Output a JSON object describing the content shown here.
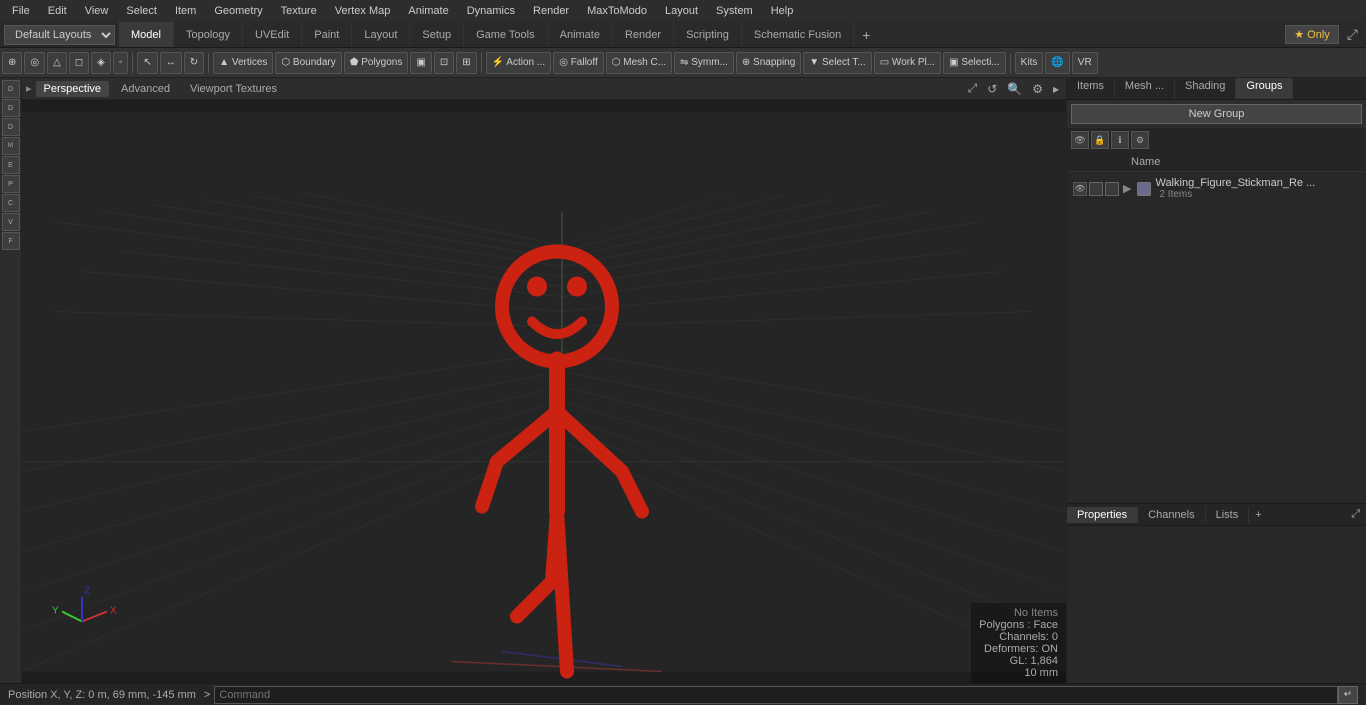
{
  "menubar": {
    "items": [
      "File",
      "Edit",
      "View",
      "Select",
      "Item",
      "Geometry",
      "Texture",
      "Vertex Map",
      "Animate",
      "Dynamics",
      "Render",
      "MaxToModo",
      "Layout",
      "System",
      "Help"
    ]
  },
  "layout_bar": {
    "dropdown": "Default Layouts",
    "tabs": [
      "Model",
      "Topology",
      "UVEdit",
      "Paint",
      "Layout",
      "Setup",
      "Game Tools",
      "Animate",
      "Render",
      "Scripting",
      "Schematic Fusion"
    ],
    "active_tab": "Model",
    "star_only": "★ Only"
  },
  "toolbar": {
    "buttons": [
      {
        "label": "⊕",
        "name": "item-mode"
      },
      {
        "label": "⊙",
        "name": "component-mode"
      },
      {
        "label": "△",
        "name": "vertex-mode"
      },
      {
        "label": "◻",
        "name": "edge-mode"
      },
      {
        "label": "◈",
        "name": "polygon-mode"
      },
      {
        "label": "◦",
        "name": "material-mode"
      },
      {
        "label": "⬡",
        "name": "select-tool"
      },
      {
        "label": "↔",
        "name": "transform-tool"
      },
      {
        "label": "✦",
        "name": "rotate-tool"
      },
      {
        "label": "Vertices",
        "name": "vertices-btn"
      },
      {
        "label": "Boundary",
        "name": "boundary-btn"
      },
      {
        "label": "Polygons",
        "name": "polygons-btn"
      },
      {
        "label": "▣",
        "name": "display-btn"
      },
      {
        "label": "⊡",
        "name": "wireframe-btn"
      },
      {
        "label": "⊞",
        "name": "solid-btn"
      },
      {
        "label": "Action...",
        "name": "action-btn"
      },
      {
        "label": "Falloff",
        "name": "falloff-btn"
      },
      {
        "label": "Mesh C...",
        "name": "mesh-btn"
      },
      {
        "label": "Symm...",
        "name": "symmetry-btn"
      },
      {
        "label": "Snapping",
        "name": "snapping-btn"
      },
      {
        "label": "Select T...",
        "name": "select-type-btn"
      },
      {
        "label": "Work Pl...",
        "name": "workplane-btn"
      },
      {
        "label": "Selecti...",
        "name": "selection-btn"
      },
      {
        "label": "Kits",
        "name": "kits-btn"
      }
    ]
  },
  "viewport": {
    "tabs": [
      "Perspective",
      "Advanced",
      "Viewport Textures"
    ],
    "active_tab": "Perspective",
    "status": {
      "no_items": "No Items",
      "polygons": "Polygons : Face",
      "channels": "Channels: 0",
      "deformers": "Deformers: ON",
      "gl": "GL: 1,864",
      "grid": "10 mm"
    }
  },
  "right_panel": {
    "tabs": [
      "Items",
      "Mesh ...",
      "Shading",
      "Groups"
    ],
    "active_tab": "Groups",
    "new_group_btn": "New Group",
    "col_header": "Name",
    "group_item": {
      "name": "Walking_Figure_Stickman_Re ...",
      "count": "2 Items"
    }
  },
  "lower_panel": {
    "tabs": [
      "Properties",
      "Channels",
      "Lists"
    ],
    "active_tab": "Properties",
    "plus": "+"
  },
  "statusbar": {
    "position": "Position X, Y, Z:  0 m, 69 mm, -145 mm",
    "command_prefix": ">",
    "command_placeholder": "Command"
  },
  "left_sidebar": {
    "items": [
      "D",
      "D",
      "D",
      "M",
      "E",
      "P",
      "C",
      "V",
      "F"
    ]
  },
  "colors": {
    "accent": "#cc3322",
    "active_tab_bg": "#3a3a3a",
    "panel_bg": "#2d2d2d",
    "toolbar_bg": "#333333"
  }
}
